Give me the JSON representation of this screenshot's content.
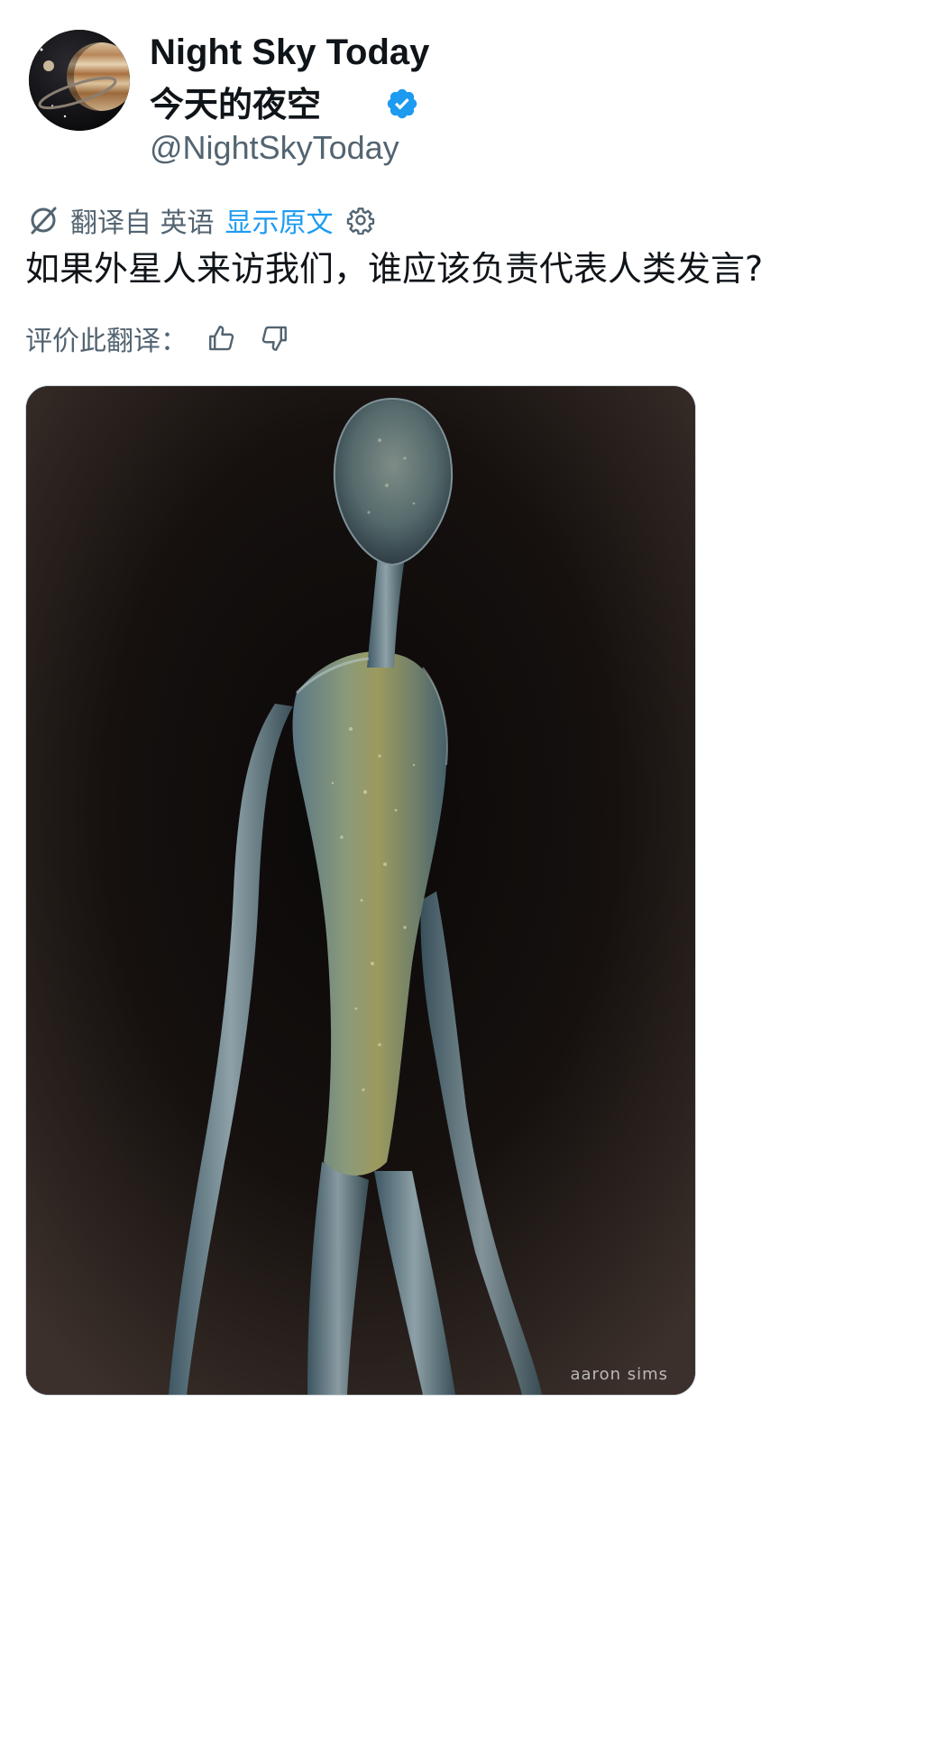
{
  "author": {
    "display_name": "Night Sky Today",
    "display_name_cn": "今天的夜空",
    "handle": "@NightSkyToday",
    "verified": true,
    "avatar_icon": "saturn-planet-avatar"
  },
  "translation": {
    "icon": "translate-globe-icon",
    "label": "翻译自 英语",
    "show_original": "显示原文",
    "settings_icon": "gear-icon"
  },
  "tweet": {
    "text": "如果外星人来访我们，谁应该负责代表人类发言?"
  },
  "rating": {
    "label": "评价此翻译：",
    "thumbs_up_icon": "thumbs-up-icon",
    "thumbs_down_icon": "thumbs-down-icon"
  },
  "media": {
    "icon": "alien-figure-artwork",
    "signature": "aaron sims"
  },
  "colors": {
    "text_primary": "#0f1419",
    "text_secondary": "#536471",
    "link": "#1d9bf0",
    "verified": "#1d9bf0"
  }
}
